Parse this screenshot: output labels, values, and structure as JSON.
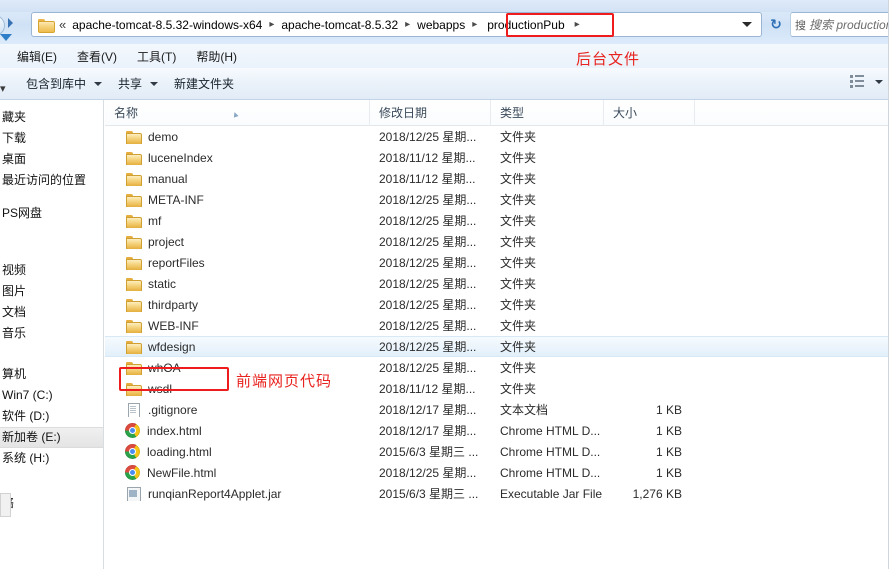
{
  "window": {
    "title": "productionPub"
  },
  "address_bar": {
    "folder_icon": "folder-icon",
    "chevrons": "«",
    "separator": "▸",
    "crumbs": [
      "apache-tomcat-8.5.32-windows-x64",
      "apache-tomcat-8.5.32",
      "webapps",
      "productionPub"
    ],
    "dropdown_icon": "chevron-down-icon",
    "refresh_icon": "refresh-icon",
    "refresh_glyph": "↻"
  },
  "search": {
    "icon": "search-icon",
    "glyph": "搜",
    "placeholder": "搜索 productionPub",
    "value": ""
  },
  "menu_bar": {
    "items": [
      {
        "label": "编辑(E)",
        "name": "menu-edit"
      },
      {
        "label": "查看(V)",
        "name": "menu-view"
      },
      {
        "label": "工具(T)",
        "name": "menu-tools"
      },
      {
        "label": "帮助(H)",
        "name": "menu-help"
      }
    ]
  },
  "toolbar": {
    "organize_truncated": "▾",
    "items": [
      {
        "label": "包含到库中",
        "has_caret": true
      },
      {
        "label": "共享",
        "has_caret": true
      },
      {
        "label": "新建文件夹",
        "has_caret": false
      }
    ],
    "view_icon": "view-options-icon",
    "view_caret_icon": "chevron-down-icon",
    "help_icon": "help-icon"
  },
  "nav_pane": {
    "groups": [
      {
        "items": [
          {
            "label": "藏夹",
            "name": "nav-favorites"
          },
          {
            "label": "下载",
            "name": "nav-downloads"
          },
          {
            "label": "桌面",
            "name": "nav-desktop"
          },
          {
            "label": "最近访问的位置",
            "name": "nav-recent-places"
          }
        ]
      },
      {
        "items": [
          {
            "label": "PS网盘",
            "name": "nav-ps-netdisk"
          }
        ]
      },
      {
        "items": [
          {
            "label": "视频",
            "name": "nav-videos"
          },
          {
            "label": "图片",
            "name": "nav-pictures"
          },
          {
            "label": "文档",
            "name": "nav-documents"
          },
          {
            "label": "音乐",
            "name": "nav-music"
          }
        ]
      },
      {
        "items": [
          {
            "label": "算机",
            "name": "nav-computer"
          },
          {
            "label": "Win7 (C:)",
            "name": "nav-drive-c"
          },
          {
            "label": "软件 (D:)",
            "name": "nav-drive-d"
          },
          {
            "label": "新加卷 (E:)",
            "name": "nav-drive-e",
            "selected": true
          },
          {
            "label": "系统 (H:)",
            "name": "nav-drive-h"
          }
        ]
      },
      {
        "items": [
          {
            "label": "络",
            "name": "nav-network"
          }
        ]
      }
    ]
  },
  "file_list": {
    "columns": [
      {
        "label": "名称",
        "name": "column-name"
      },
      {
        "label": "修改日期",
        "name": "column-date-modified"
      },
      {
        "label": "类型",
        "name": "column-type"
      },
      {
        "label": "大小",
        "name": "column-size"
      }
    ],
    "sort_indicator": "▴",
    "rows": [
      {
        "name": "demo",
        "date": "2018/12/25 星期...",
        "type": "文件夹",
        "size": "",
        "icon": "folder-icon"
      },
      {
        "name": "luceneIndex",
        "date": "2018/11/12 星期...",
        "type": "文件夹",
        "size": "",
        "icon": "folder-icon"
      },
      {
        "name": "manual",
        "date": "2018/11/12 星期...",
        "type": "文件夹",
        "size": "",
        "icon": "folder-icon"
      },
      {
        "name": "META-INF",
        "date": "2018/12/25 星期...",
        "type": "文件夹",
        "size": "",
        "icon": "folder-icon"
      },
      {
        "name": "mf",
        "date": "2018/12/25 星期...",
        "type": "文件夹",
        "size": "",
        "icon": "folder-icon"
      },
      {
        "name": "project",
        "date": "2018/12/25 星期...",
        "type": "文件夹",
        "size": "",
        "icon": "folder-icon"
      },
      {
        "name": "reportFiles",
        "date": "2018/12/25 星期...",
        "type": "文件夹",
        "size": "",
        "icon": "folder-icon"
      },
      {
        "name": "static",
        "date": "2018/12/25 星期...",
        "type": "文件夹",
        "size": "",
        "icon": "folder-icon"
      },
      {
        "name": "thirdparty",
        "date": "2018/12/25 星期...",
        "type": "文件夹",
        "size": "",
        "icon": "folder-icon"
      },
      {
        "name": "WEB-INF",
        "date": "2018/12/25 星期...",
        "type": "文件夹",
        "size": "",
        "icon": "folder-icon"
      },
      {
        "name": "wfdesign",
        "date": "2018/12/25 星期...",
        "type": "文件夹",
        "size": "",
        "icon": "folder-icon",
        "hover": true
      },
      {
        "name": "whOA",
        "date": "2018/12/25 星期...",
        "type": "文件夹",
        "size": "",
        "icon": "folder-icon"
      },
      {
        "name": "wsdl",
        "date": "2018/11/12 星期...",
        "type": "文件夹",
        "size": "",
        "icon": "folder-icon"
      },
      {
        "name": ".gitignore",
        "date": "2018/12/17 星期...",
        "type": "文本文档",
        "size": "1 KB",
        "icon": "text-document-icon"
      },
      {
        "name": "index.html",
        "date": "2018/12/17 星期...",
        "type": "Chrome HTML D...",
        "size": "1 KB",
        "icon": "chrome-icon"
      },
      {
        "name": "loading.html",
        "date": "2015/6/3 星期三 ...",
        "type": "Chrome HTML D...",
        "size": "1 KB",
        "icon": "chrome-icon"
      },
      {
        "name": "NewFile.html",
        "date": "2018/12/25 星期...",
        "type": "Chrome HTML D...",
        "size": "1 KB",
        "icon": "chrome-icon"
      },
      {
        "name": "runqianReport4Applet.jar",
        "date": "2015/6/3 星期三 ...",
        "type": "Executable Jar File",
        "size": "1,276 KB",
        "icon": "jar-icon"
      }
    ]
  },
  "annotations": {
    "accent_color": "#ee1c1c",
    "backend_label": "后台文件",
    "frontend_label": "前端网页代码"
  }
}
